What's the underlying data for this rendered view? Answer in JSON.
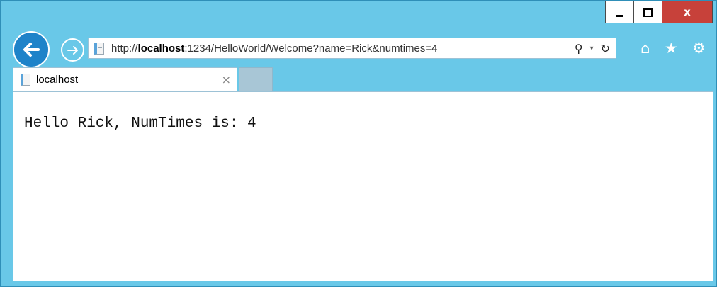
{
  "window": {
    "controls": {
      "minimize_icon": "minimize-icon",
      "maximize_icon": "maximize-icon",
      "close_label": "x"
    }
  },
  "nav": {
    "back_icon": "back-arrow-icon",
    "forward_icon": "forward-arrow-icon",
    "address": {
      "prefix": "http://",
      "host": "localhost",
      "path": ":1234/HelloWorld/Welcome?name=Rick&numtimes=4"
    },
    "search_glyph": "⚲",
    "dropdown_glyph": "▾",
    "refresh_glyph": "↻",
    "right_icons": [
      "home-icon",
      "favorites-star-icon",
      "settings-gear-icon"
    ],
    "home_glyph": "⌂",
    "star_glyph": "★",
    "gear_glyph": "⚙"
  },
  "tabs": [
    {
      "title": "localhost",
      "close_glyph": "×"
    }
  ],
  "content": {
    "text": "Hello Rick, NumTimes is: 4"
  },
  "colors": {
    "frame": "#69c8e8",
    "back_button": "#1e83c9",
    "close_button": "#c7413a"
  }
}
